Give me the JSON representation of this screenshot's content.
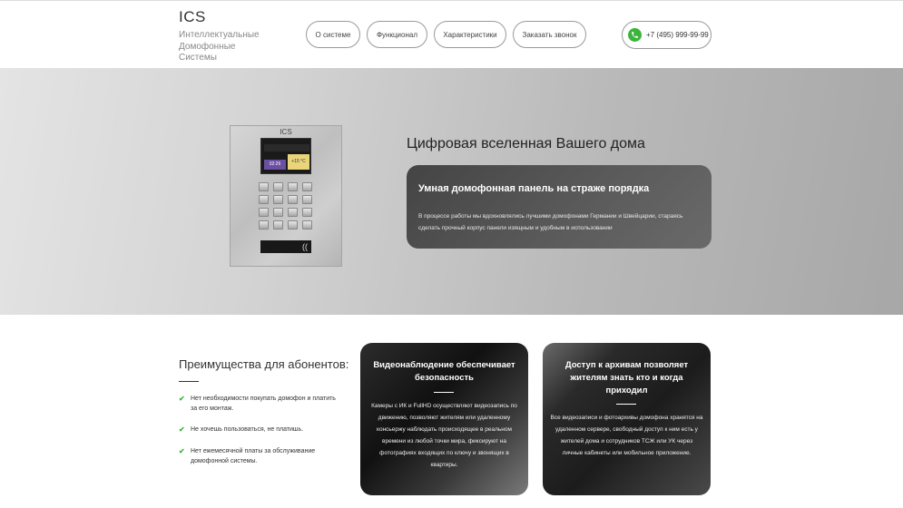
{
  "header": {
    "logo": "ICS",
    "tagline": [
      "Интеллектуальные",
      "Домофонные",
      "Системы"
    ],
    "nav": [
      "О системе",
      "Функционал",
      "Характеристики",
      "Заказать звонок"
    ],
    "phone": "+7 (495) 999-99-99"
  },
  "hero": {
    "title": "Цифровая вселенная Вашего дома",
    "card_title": "Умная домофонная панель на страже порядка",
    "card_text": "В процессе работы мы вдохновлялись лучшими домофонами Германии и Швейцарии, стараясь сделать прочный корпус панели изящным и удобным в использовании",
    "panel": {
      "brand": "ICS",
      "time": "02:26",
      "temp": "+15 °C"
    }
  },
  "advantages": {
    "title": "Преимущества для абонентов:",
    "items": [
      "Нет необходимости покупать домофон и платить за его монтаж.",
      "Не хочешь пользоваться, не платишь.",
      "Нет ежемесячной платы за обслуживание домофонной системы."
    ]
  },
  "cards": [
    {
      "title": "Видеонаблюдение обеспечивает безопасность",
      "text": "Камеры с ИК и FullHD осуществляют видеозапись по движению, позволяют жителям или удаленному консьержу наблюдать происходящее в реальном времени из любой точки мира, фиксируют на фотографиях входящих по ключу и звонящих в квартиры."
    },
    {
      "title": "Доступ к архивам позволяет жителям знать кто и когда приходил",
      "text": "Все видеозаписи и фотоархивы домофона хранятся на удаленном сервере, свободный доступ к ним есть у жителей дома и сотрудников ТСЖ или УК через личные кабинеты или мобильное приложение."
    }
  ],
  "colors": {
    "accent_green": "#3cb43c",
    "card_dark": "#2c2c2c"
  }
}
